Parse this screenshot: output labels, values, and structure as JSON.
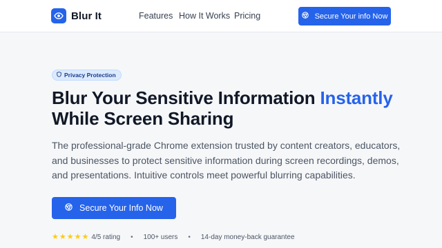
{
  "header": {
    "brand": "Blur It",
    "nav": [
      "Features",
      "How It Works",
      "Pricing"
    ],
    "cta_label": "Secure Your info Now"
  },
  "hero": {
    "badge": "Privacy Protection",
    "headline_part1": "Blur Your Sensitive Information ",
    "headline_accent": "Instantly",
    "headline_part2": "While Screen Sharing",
    "description": "The professional-grade Chrome extension trusted by content creators, educators, and businesses to protect sensitive information during screen recordings, demos, and presentations. Intuitive controls meet powerful blurring capabilities.",
    "cta_label": "Secure Your Info Now"
  },
  "social_proof": {
    "stars": 5,
    "rating_text": "4/5 rating",
    "users_text": "100+ users",
    "guarantee_text": "14-day money-back guarantee"
  },
  "colors": {
    "accent": "#2563eb",
    "star": "#facc15",
    "badge_bg": "#dbeafe"
  },
  "icons": [
    "eye-icon",
    "chrome-icon",
    "shield-icon",
    "star-icon"
  ]
}
